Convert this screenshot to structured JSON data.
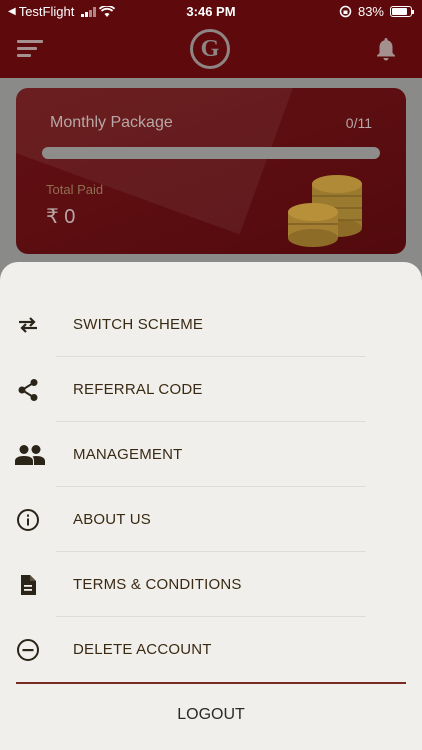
{
  "status_bar": {
    "back_app": "TestFlight",
    "time": "3:46 PM",
    "battery_percent": "83%",
    "battery_level": 0.83
  },
  "header": {
    "logo_text": "G",
    "icons": [
      "menu-icon",
      "bell-icon"
    ]
  },
  "package_card": {
    "title": "Monthly Package",
    "count": "0/11",
    "progress": 0,
    "total_paid_label": "Total Paid",
    "total_paid_amount": "₹ 0"
  },
  "menu": {
    "items": [
      {
        "label": "SWITCH SCHEME",
        "icon": "swap-icon"
      },
      {
        "label": "REFERRAL CODE",
        "icon": "share-icon"
      },
      {
        "label": "MANAGEMENT",
        "icon": "people-icon"
      },
      {
        "label": "ABOUT US",
        "icon": "info-icon"
      },
      {
        "label": "TERMS & CONDITIONS",
        "icon": "document-icon"
      },
      {
        "label": "DELETE ACCOUNT",
        "icon": "minus-circle-icon"
      }
    ],
    "logout_label": "LOGOUT"
  },
  "colors": {
    "header": "#5e0a0d",
    "card": "#5a0d10",
    "sheet": "#f0efeb",
    "text": "#3a2a14",
    "accent_line": "#7a2a25"
  }
}
